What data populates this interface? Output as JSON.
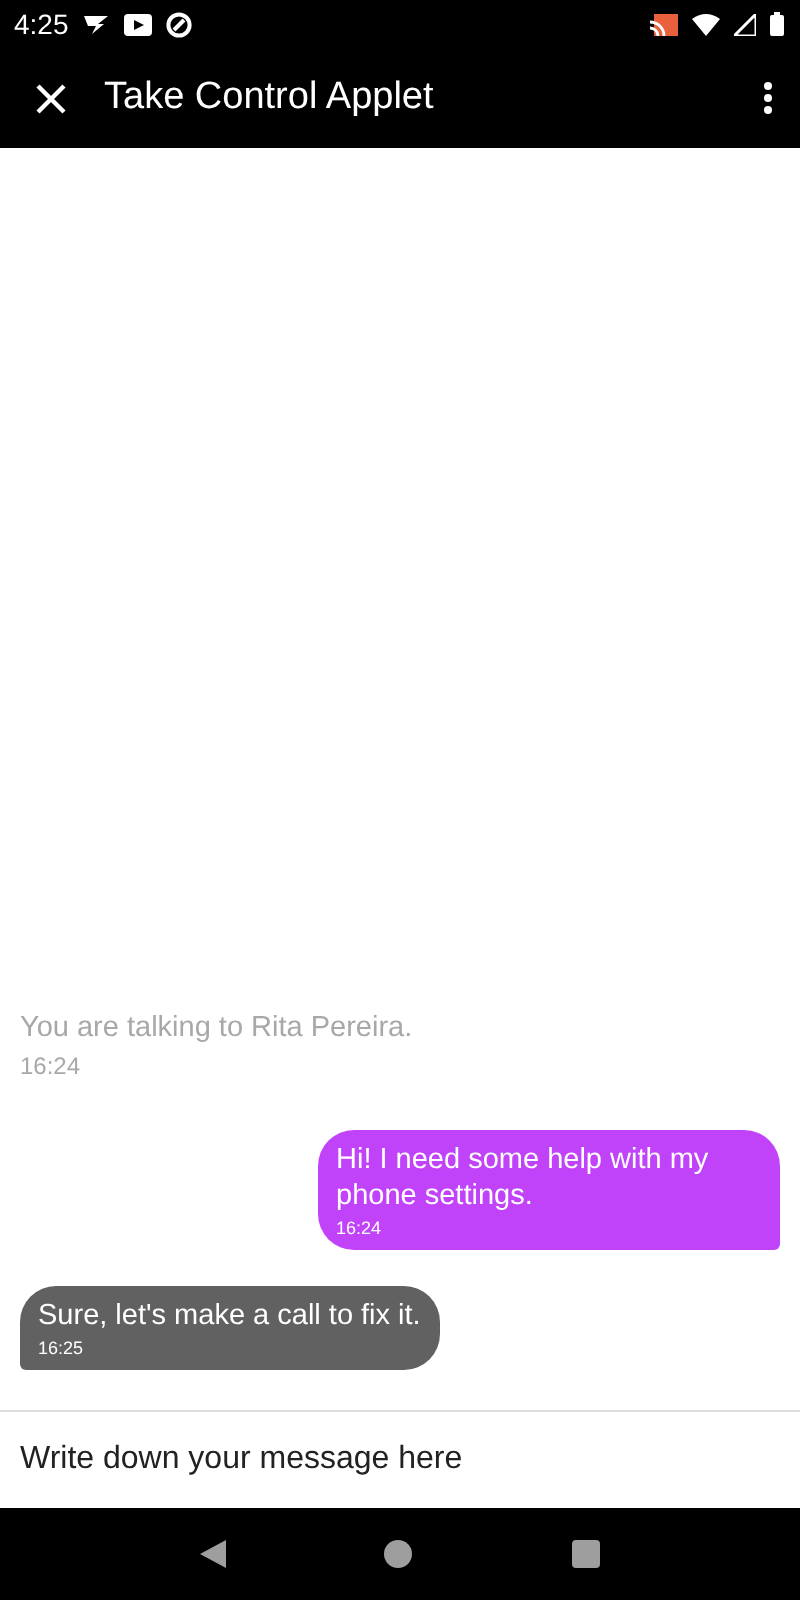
{
  "status_bar": {
    "time": "4:25"
  },
  "app_bar": {
    "title": "Take Control Applet"
  },
  "messages": [
    {
      "kind": "system",
      "text": "You are talking to Rita Pereira.",
      "time": "16:24"
    },
    {
      "kind": "outgoing",
      "text": "Hi! I need some help with my phone settings.",
      "time": "16:24"
    },
    {
      "kind": "incoming",
      "text": "Sure, let's make a call to fix it.",
      "time": "16:25"
    }
  ],
  "composer": {
    "placeholder": "Write down your message here"
  }
}
